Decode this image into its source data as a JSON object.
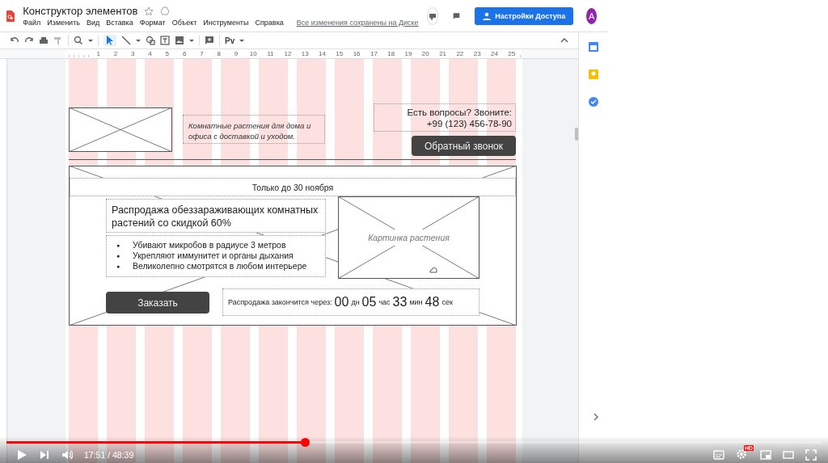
{
  "document": {
    "title": "Конструктор элементов",
    "menu": [
      "Файл",
      "Изменить",
      "Вид",
      "Вставка",
      "Формат",
      "Объект",
      "Инструменты",
      "Справка"
    ],
    "save_status": "Все изменения сохранены на Диске",
    "share_button": "Настройки Доступа",
    "avatar": "A"
  },
  "toolbar": {
    "text_tool": "Pv"
  },
  "ruler_marks": [
    "1",
    "2",
    "3",
    "4",
    "5",
    "6",
    "7",
    "8",
    "9",
    "10",
    "11",
    "12",
    "13",
    "14",
    "15",
    "16",
    "17",
    "18",
    "19",
    "20",
    "21",
    "22",
    "23",
    "24",
    "25"
  ],
  "wireframe": {
    "tagline": "Комнатные растения для дома и офиса с доставкой и уходом.",
    "contact_lines": [
      "Есть вопросы? Звоните:",
      "+99 (123) 456-78-90"
    ],
    "callback_button": "Обратный звонок",
    "banner_label": "Только до 30 ноября",
    "headline": "Распродажа обеззараживающих комнатных растений со скидкой 60%",
    "bullets": [
      {
        "marker": "●",
        "text": "Убивают микробов в радиусе 3 метров"
      },
      {
        "marker": "●",
        "text": "Укрепляют иммунитет и органы дыхания"
      },
      {
        "marker": "●",
        "text": "Великолепно смотрятся в любом интерьере"
      }
    ],
    "image_caption": "Картинка растения",
    "order_button": "Заказать",
    "countdown": {
      "label": "Распродажа закончится через:",
      "parts": [
        {
          "value": "00",
          "unit": "дн"
        },
        {
          "value": "05",
          "unit": "час"
        },
        {
          "value": "33",
          "unit": "мин"
        },
        {
          "value": "48",
          "unit": "сек"
        }
      ]
    }
  },
  "player": {
    "progress": {
      "level": 0.366
    },
    "time": "17:51 / 48:39",
    "quality_badge": "HD"
  }
}
